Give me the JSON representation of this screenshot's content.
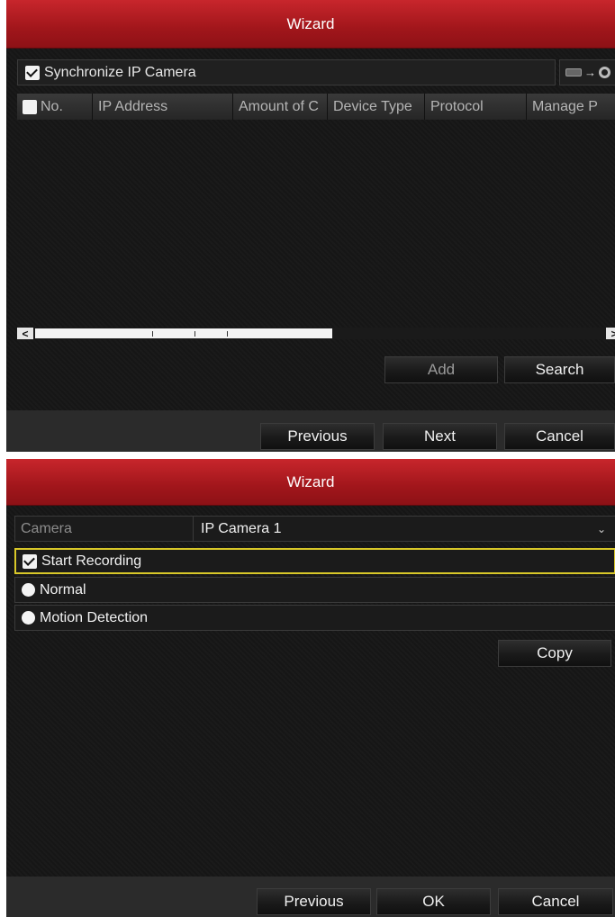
{
  "wizard1": {
    "title": "Wizard",
    "sync_label": "Synchronize IP Camera",
    "sync_checked": true,
    "sync_icon_arrow": "→",
    "columns": [
      "No.",
      "IP Address",
      "Amount of C",
      "Device Type",
      "Protocol",
      "Manage P"
    ],
    "rows": [],
    "scroll_left": "<",
    "scroll_right": ">",
    "add_label": "Add",
    "search_label": "Search",
    "previous_label": "Previous",
    "next_label": "Next",
    "cancel_label": "Cancel"
  },
  "wizard2": {
    "title": "Wizard",
    "camera_label": "Camera",
    "camera_value": "IP Camera 1",
    "start_recording_label": "Start Recording",
    "start_recording_checked": true,
    "normal_label": "Normal",
    "motion_label": "Motion Detection",
    "copy_label": "Copy",
    "previous_label": "Previous",
    "ok_label": "OK",
    "cancel_label": "Cancel"
  },
  "colors": {
    "titlebar": "#b31d22",
    "background": "#161616",
    "focus_border": "#d9c829"
  }
}
